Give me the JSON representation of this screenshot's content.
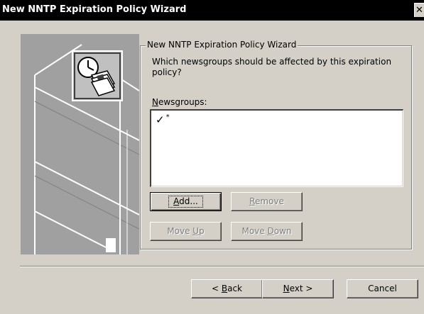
{
  "window": {
    "title": "New NNTP Expiration Policy Wizard",
    "close_glyph": "✕"
  },
  "group": {
    "label": "New NNTP Expiration Policy Wizard",
    "question": "Which newsgroups should be affected by this expiration policy?",
    "newsgroups_label_mnemonic": "N",
    "newsgroups_label_rest": "ewsgroups:"
  },
  "newsgroups": {
    "items": [
      {
        "checked": true,
        "check_glyph": "✓",
        "pattern": "*"
      }
    ]
  },
  "buttons": {
    "add": {
      "mnemonic": "A",
      "rest": "dd...",
      "enabled": true
    },
    "remove": {
      "mnemonic": "R",
      "rest": "emove",
      "enabled": false
    },
    "move_up": {
      "pre": "Move ",
      "mnemonic": "U",
      "rest": "p",
      "enabled": false
    },
    "move_down": {
      "pre": "Move ",
      "mnemonic": "D",
      "rest": "own",
      "enabled": false
    }
  },
  "footer": {
    "back": {
      "pre": "< ",
      "mnemonic": "B",
      "rest": "ack"
    },
    "next": {
      "mnemonic": "N",
      "rest": "ext >"
    },
    "cancel": "Cancel"
  },
  "colors": {
    "face": "#d4d0c8",
    "titlebar": "#000000",
    "art_background": "#a0a0a0",
    "disabled_text": "#808080"
  },
  "icons": {
    "wizard_art": "server-tower-illustration",
    "policy_icon": "clock-newspaper-icon"
  }
}
